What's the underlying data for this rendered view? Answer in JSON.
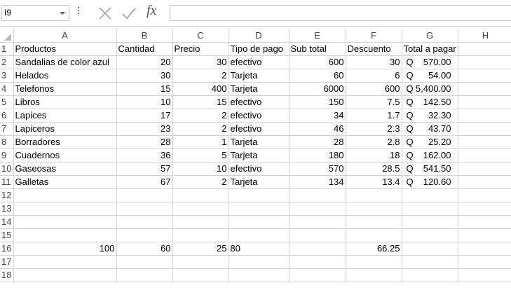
{
  "formula_bar": {
    "name_box": "I9",
    "fx": "fx",
    "formula": ""
  },
  "columns": [
    "A",
    "B",
    "C",
    "D",
    "E",
    "F",
    "G",
    "H"
  ],
  "rows": [
    {
      "n": "1",
      "a": "Productos",
      "b": "Cantidad",
      "c": "Precio",
      "d": "Tipo de pago",
      "e": "Sub total",
      "f": "Descuento",
      "gq": "",
      "gv": "Total a pagar"
    },
    {
      "n": "2",
      "a": "Sandalias de color azul",
      "b": "20",
      "c": "30",
      "d": "efectivo",
      "e": "600",
      "f": "30",
      "gq": "Q",
      "gv": "570.00"
    },
    {
      "n": "3",
      "a": "Helados",
      "b": "30",
      "c": "2",
      "d": "Tarjeta",
      "e": "60",
      "f": "6",
      "gq": "Q",
      "gv": "54.00"
    },
    {
      "n": "4",
      "a": "Telefonos",
      "b": "15",
      "c": "400",
      "d": "Tarjeta",
      "e": "6000",
      "f": "600",
      "gq": "Q",
      "gv": "5,400.00"
    },
    {
      "n": "5",
      "a": "Libros",
      "b": "10",
      "c": "15",
      "d": "efectivo",
      "e": "150",
      "f": "7.5",
      "gq": "Q",
      "gv": "142.50"
    },
    {
      "n": "6",
      "a": "Lapices",
      "b": "17",
      "c": "2",
      "d": "efectivo",
      "e": "34",
      "f": "1.7",
      "gq": "Q",
      "gv": "32.30"
    },
    {
      "n": "7",
      "a": "Lapiceros",
      "b": "23",
      "c": "2",
      "d": "efectivo",
      "e": "46",
      "f": "2.3",
      "gq": "Q",
      "gv": "43.70"
    },
    {
      "n": "8",
      "a": "Borradores",
      "b": "28",
      "c": "1",
      "d": "Tarjeta",
      "e": "28",
      "f": "2.8",
      "gq": "Q",
      "gv": "25.20"
    },
    {
      "n": "9",
      "a": "Cuadernos",
      "b": "36",
      "c": "5",
      "d": "Tarjeta",
      "e": "180",
      "f": "18",
      "gq": "Q",
      "gv": "162.00"
    },
    {
      "n": "10",
      "a": "Gaseosas",
      "b": "57",
      "c": "10",
      "d": "efectivo",
      "e": "570",
      "f": "28.5",
      "gq": "Q",
      "gv": "541.50"
    },
    {
      "n": "11",
      "a": "Galletas",
      "b": "67",
      "c": "2",
      "d": "Tarjeta",
      "e": "134",
      "f": "13.4",
      "gq": "Q",
      "gv": "120.60"
    },
    {
      "n": "12",
      "a": "",
      "b": "",
      "c": "",
      "d": "",
      "e": "",
      "f": "",
      "gq": "",
      "gv": ""
    },
    {
      "n": "13",
      "a": "",
      "b": "",
      "c": "",
      "d": "",
      "e": "",
      "f": "",
      "gq": "",
      "gv": ""
    },
    {
      "n": "14",
      "a": "",
      "b": "",
      "c": "",
      "d": "",
      "e": "",
      "f": "",
      "gq": "",
      "gv": ""
    },
    {
      "n": "15",
      "a": "",
      "b": "",
      "c": "",
      "d": "",
      "e": "",
      "f": "",
      "gq": "",
      "gv": ""
    },
    {
      "n": "16",
      "a": "100",
      "b": "60",
      "c": "25",
      "d": "80",
      "e": "",
      "f": "66.25",
      "gq": "",
      "gv": ""
    },
    {
      "n": "17",
      "a": "",
      "b": "",
      "c": "",
      "d": "",
      "e": "",
      "f": "",
      "gq": "",
      "gv": ""
    },
    {
      "n": "18",
      "a": "",
      "b": "",
      "c": "",
      "d": "",
      "e": "",
      "f": "",
      "gq": "",
      "gv": ""
    }
  ]
}
